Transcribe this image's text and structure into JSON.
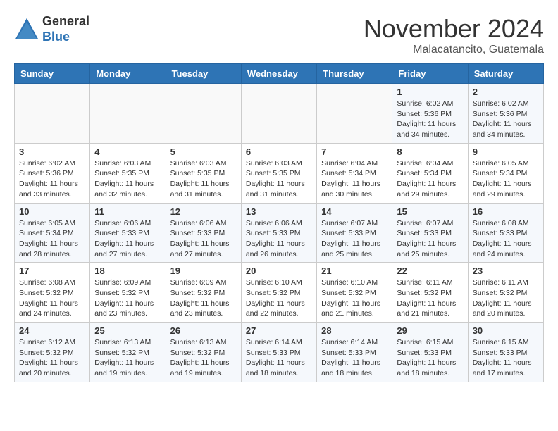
{
  "logo": {
    "general": "General",
    "blue": "Blue"
  },
  "title": "November 2024",
  "location": "Malacatancito, Guatemala",
  "days_of_week": [
    "Sunday",
    "Monday",
    "Tuesday",
    "Wednesday",
    "Thursday",
    "Friday",
    "Saturday"
  ],
  "weeks": [
    [
      {
        "day": "",
        "info": ""
      },
      {
        "day": "",
        "info": ""
      },
      {
        "day": "",
        "info": ""
      },
      {
        "day": "",
        "info": ""
      },
      {
        "day": "",
        "info": ""
      },
      {
        "day": "1",
        "info": "Sunrise: 6:02 AM\nSunset: 5:36 PM\nDaylight: 11 hours and 34 minutes."
      },
      {
        "day": "2",
        "info": "Sunrise: 6:02 AM\nSunset: 5:36 PM\nDaylight: 11 hours and 34 minutes."
      }
    ],
    [
      {
        "day": "3",
        "info": "Sunrise: 6:02 AM\nSunset: 5:36 PM\nDaylight: 11 hours and 33 minutes."
      },
      {
        "day": "4",
        "info": "Sunrise: 6:03 AM\nSunset: 5:35 PM\nDaylight: 11 hours and 32 minutes."
      },
      {
        "day": "5",
        "info": "Sunrise: 6:03 AM\nSunset: 5:35 PM\nDaylight: 11 hours and 31 minutes."
      },
      {
        "day": "6",
        "info": "Sunrise: 6:03 AM\nSunset: 5:35 PM\nDaylight: 11 hours and 31 minutes."
      },
      {
        "day": "7",
        "info": "Sunrise: 6:04 AM\nSunset: 5:34 PM\nDaylight: 11 hours and 30 minutes."
      },
      {
        "day": "8",
        "info": "Sunrise: 6:04 AM\nSunset: 5:34 PM\nDaylight: 11 hours and 29 minutes."
      },
      {
        "day": "9",
        "info": "Sunrise: 6:05 AM\nSunset: 5:34 PM\nDaylight: 11 hours and 29 minutes."
      }
    ],
    [
      {
        "day": "10",
        "info": "Sunrise: 6:05 AM\nSunset: 5:34 PM\nDaylight: 11 hours and 28 minutes."
      },
      {
        "day": "11",
        "info": "Sunrise: 6:06 AM\nSunset: 5:33 PM\nDaylight: 11 hours and 27 minutes."
      },
      {
        "day": "12",
        "info": "Sunrise: 6:06 AM\nSunset: 5:33 PM\nDaylight: 11 hours and 27 minutes."
      },
      {
        "day": "13",
        "info": "Sunrise: 6:06 AM\nSunset: 5:33 PM\nDaylight: 11 hours and 26 minutes."
      },
      {
        "day": "14",
        "info": "Sunrise: 6:07 AM\nSunset: 5:33 PM\nDaylight: 11 hours and 25 minutes."
      },
      {
        "day": "15",
        "info": "Sunrise: 6:07 AM\nSunset: 5:33 PM\nDaylight: 11 hours and 25 minutes."
      },
      {
        "day": "16",
        "info": "Sunrise: 6:08 AM\nSunset: 5:33 PM\nDaylight: 11 hours and 24 minutes."
      }
    ],
    [
      {
        "day": "17",
        "info": "Sunrise: 6:08 AM\nSunset: 5:32 PM\nDaylight: 11 hours and 24 minutes."
      },
      {
        "day": "18",
        "info": "Sunrise: 6:09 AM\nSunset: 5:32 PM\nDaylight: 11 hours and 23 minutes."
      },
      {
        "day": "19",
        "info": "Sunrise: 6:09 AM\nSunset: 5:32 PM\nDaylight: 11 hours and 23 minutes."
      },
      {
        "day": "20",
        "info": "Sunrise: 6:10 AM\nSunset: 5:32 PM\nDaylight: 11 hours and 22 minutes."
      },
      {
        "day": "21",
        "info": "Sunrise: 6:10 AM\nSunset: 5:32 PM\nDaylight: 11 hours and 21 minutes."
      },
      {
        "day": "22",
        "info": "Sunrise: 6:11 AM\nSunset: 5:32 PM\nDaylight: 11 hours and 21 minutes."
      },
      {
        "day": "23",
        "info": "Sunrise: 6:11 AM\nSunset: 5:32 PM\nDaylight: 11 hours and 20 minutes."
      }
    ],
    [
      {
        "day": "24",
        "info": "Sunrise: 6:12 AM\nSunset: 5:32 PM\nDaylight: 11 hours and 20 minutes."
      },
      {
        "day": "25",
        "info": "Sunrise: 6:13 AM\nSunset: 5:32 PM\nDaylight: 11 hours and 19 minutes."
      },
      {
        "day": "26",
        "info": "Sunrise: 6:13 AM\nSunset: 5:32 PM\nDaylight: 11 hours and 19 minutes."
      },
      {
        "day": "27",
        "info": "Sunrise: 6:14 AM\nSunset: 5:33 PM\nDaylight: 11 hours and 18 minutes."
      },
      {
        "day": "28",
        "info": "Sunrise: 6:14 AM\nSunset: 5:33 PM\nDaylight: 11 hours and 18 minutes."
      },
      {
        "day": "29",
        "info": "Sunrise: 6:15 AM\nSunset: 5:33 PM\nDaylight: 11 hours and 18 minutes."
      },
      {
        "day": "30",
        "info": "Sunrise: 6:15 AM\nSunset: 5:33 PM\nDaylight: 11 hours and 17 minutes."
      }
    ]
  ]
}
